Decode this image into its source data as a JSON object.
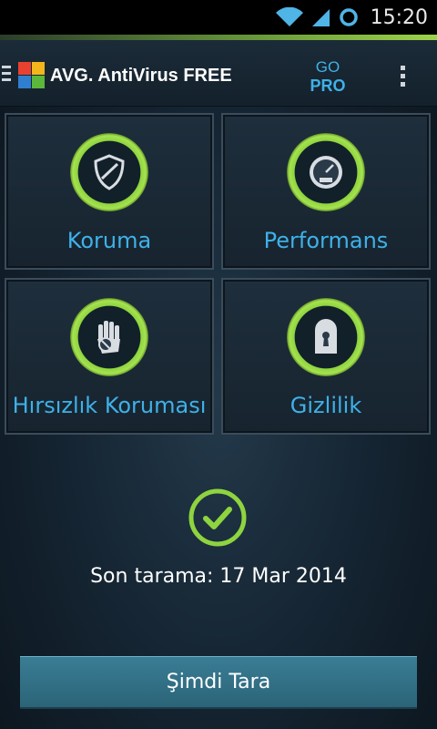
{
  "status_bar": {
    "time": "15:20",
    "icons": [
      "wifi-icon",
      "signal-icon",
      "sync-icon"
    ]
  },
  "action_bar": {
    "brand_avg": "AVG.",
    "brand_rest": "AntiVirus FREE",
    "go_label": "GO",
    "pro_label": "PRO"
  },
  "tiles": [
    {
      "label": "Koruma",
      "icon": "shield-icon"
    },
    {
      "label": "Performans",
      "icon": "speedometer-icon"
    },
    {
      "label": "Hırsızlık Koruması",
      "icon": "hand-stop-icon"
    },
    {
      "label": "Gizlilik",
      "icon": "keyhole-lock-icon"
    }
  ],
  "status": {
    "last_scan": "Son tarama: 17 Mar 2014"
  },
  "scan_button": {
    "label": "Şimdi Tara"
  },
  "colors": {
    "accent_green": "#8ed43f",
    "accent_blue": "#3fb1e8",
    "button": "#3a7d95"
  }
}
